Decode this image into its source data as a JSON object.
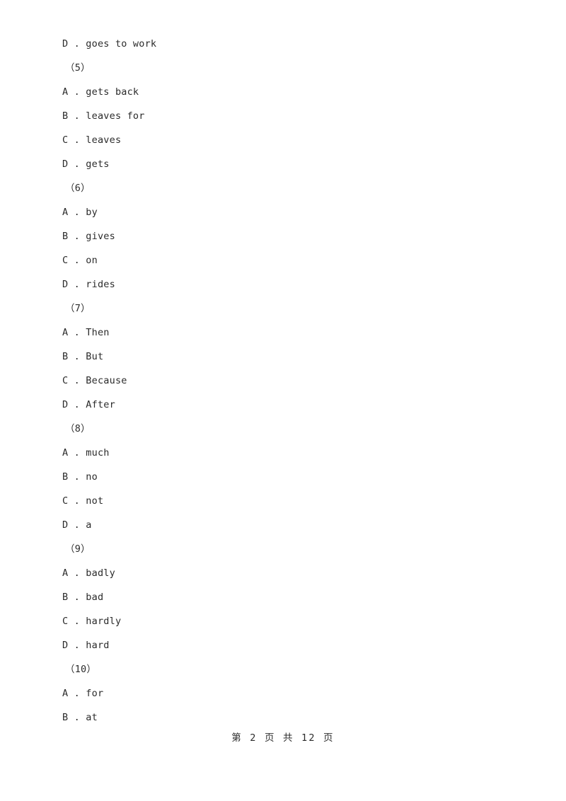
{
  "document": {
    "lines": [
      {
        "kind": "option",
        "text": "D . goes to work"
      },
      {
        "kind": "qnum",
        "text": "（5）"
      },
      {
        "kind": "option",
        "text": "A . gets back"
      },
      {
        "kind": "option",
        "text": "B . leaves for"
      },
      {
        "kind": "option",
        "text": "C . leaves"
      },
      {
        "kind": "option",
        "text": "D . gets"
      },
      {
        "kind": "qnum",
        "text": "（6）"
      },
      {
        "kind": "option",
        "text": "A . by"
      },
      {
        "kind": "option",
        "text": "B . gives"
      },
      {
        "kind": "option",
        "text": "C . on"
      },
      {
        "kind": "option",
        "text": "D . rides"
      },
      {
        "kind": "qnum",
        "text": "（7）"
      },
      {
        "kind": "option",
        "text": "A . Then"
      },
      {
        "kind": "option",
        "text": "B . But"
      },
      {
        "kind": "option",
        "text": "C . Because"
      },
      {
        "kind": "option",
        "text": "D . After"
      },
      {
        "kind": "qnum",
        "text": "（8）"
      },
      {
        "kind": "option",
        "text": "A . much"
      },
      {
        "kind": "option",
        "text": "B . no"
      },
      {
        "kind": "option",
        "text": "C . not"
      },
      {
        "kind": "option",
        "text": "D . a"
      },
      {
        "kind": "qnum",
        "text": "（9）"
      },
      {
        "kind": "option",
        "text": "A . badly"
      },
      {
        "kind": "option",
        "text": "B . bad"
      },
      {
        "kind": "option",
        "text": "C . hardly"
      },
      {
        "kind": "option",
        "text": "D . hard"
      },
      {
        "kind": "qnum",
        "text": "（10）"
      },
      {
        "kind": "option",
        "text": "A . for"
      },
      {
        "kind": "option",
        "text": "B . at"
      }
    ]
  },
  "footer": {
    "page_label": "第 2 页 共 12 页",
    "current_page": 2,
    "total_pages": 12
  },
  "colors": {
    "text": "#2b2b2b",
    "background": "#ffffff"
  }
}
